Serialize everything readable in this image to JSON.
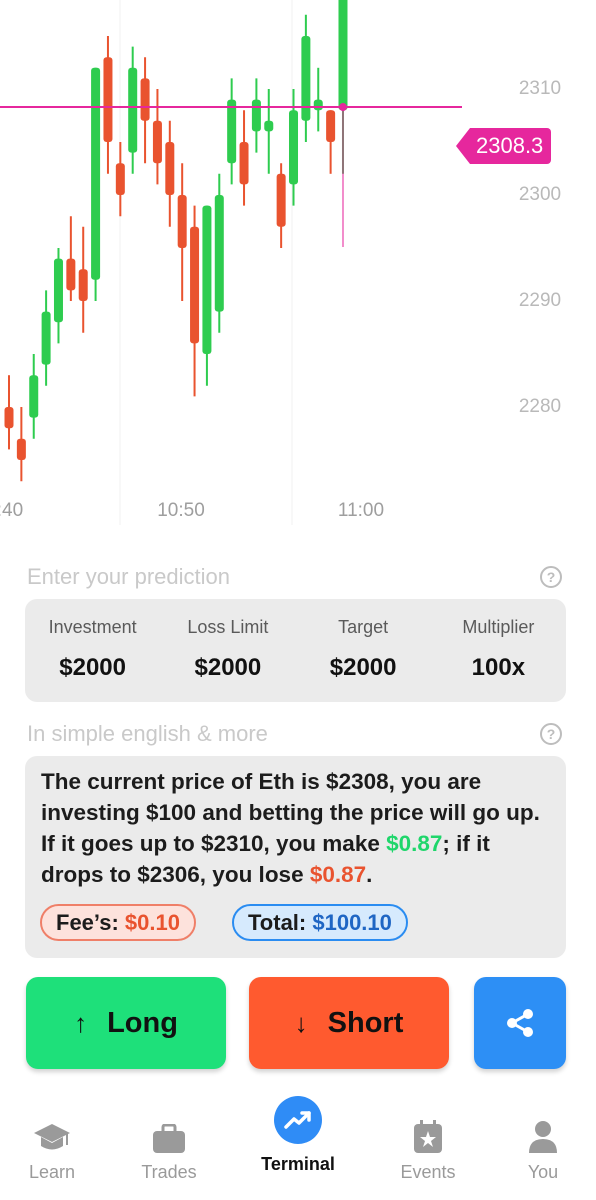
{
  "chart": {
    "current_price": "2308.3",
    "y_ticks": [
      "2310",
      "2300",
      "2290",
      "2280"
    ],
    "x_ticks": [
      ":40",
      "10:50",
      "11:00"
    ],
    "colors": {
      "up": "#2ecc4f",
      "down": "#e9532f",
      "price_line": "#e6279d"
    }
  },
  "chart_data": {
    "type": "candlestick",
    "x": [
      ":40",
      "10:50",
      "11:00"
    ],
    "ylim": [
      2277,
      2321
    ],
    "current_price": 2308.3,
    "candles": [
      {
        "o": 2280,
        "h": 2283,
        "l": 2276,
        "c": 2278
      },
      {
        "o": 2277,
        "h": 2280,
        "l": 2273,
        "c": 2275
      },
      {
        "o": 2279,
        "h": 2285,
        "l": 2277,
        "c": 2283
      },
      {
        "o": 2284,
        "h": 2291,
        "l": 2282,
        "c": 2289
      },
      {
        "o": 2288,
        "h": 2295,
        "l": 2286,
        "c": 2294
      },
      {
        "o": 2294,
        "h": 2298,
        "l": 2290,
        "c": 2291
      },
      {
        "o": 2293,
        "h": 2297,
        "l": 2287,
        "c": 2290
      },
      {
        "o": 2292,
        "h": 2310,
        "l": 2290,
        "c": 2312
      },
      {
        "o": 2313,
        "h": 2315,
        "l": 2302,
        "c": 2305
      },
      {
        "o": 2303,
        "h": 2305,
        "l": 2298,
        "c": 2300
      },
      {
        "o": 2304,
        "h": 2314,
        "l": 2302,
        "c": 2312
      },
      {
        "o": 2311,
        "h": 2313,
        "l": 2303,
        "c": 2307
      },
      {
        "o": 2307,
        "h": 2310,
        "l": 2301,
        "c": 2303
      },
      {
        "o": 2305,
        "h": 2307,
        "l": 2297,
        "c": 2300
      },
      {
        "o": 2300,
        "h": 2303,
        "l": 2290,
        "c": 2295
      },
      {
        "o": 2297,
        "h": 2299,
        "l": 2281,
        "c": 2286
      },
      {
        "o": 2285,
        "h": 2292,
        "l": 2282,
        "c": 2299
      },
      {
        "o": 2289,
        "h": 2302,
        "l": 2287,
        "c": 2300
      },
      {
        "o": 2303,
        "h": 2311,
        "l": 2301,
        "c": 2309
      },
      {
        "o": 2305,
        "h": 2308,
        "l": 2299,
        "c": 2301
      },
      {
        "o": 2306,
        "h": 2311,
        "l": 2304,
        "c": 2309
      },
      {
        "o": 2306,
        "h": 2310,
        "l": 2302,
        "c": 2307
      },
      {
        "o": 2302,
        "h": 2303,
        "l": 2295,
        "c": 2297
      },
      {
        "o": 2301,
        "h": 2310,
        "l": 2299,
        "c": 2308
      },
      {
        "o": 2307,
        "h": 2317,
        "l": 2305,
        "c": 2315
      },
      {
        "o": 2308,
        "h": 2312,
        "l": 2306,
        "c": 2309
      },
      {
        "o": 2308,
        "h": 2306,
        "l": 2302,
        "c": 2305
      },
      {
        "o": 2308,
        "h": 2322,
        "l": 2302,
        "c": 2320
      }
    ]
  },
  "prediction": {
    "section_title": "Enter your prediction",
    "fields": [
      {
        "label": "Investment",
        "value": "$2000"
      },
      {
        "label": "Loss Limit",
        "value": "$2000"
      },
      {
        "label": "Target",
        "value": "$2000"
      },
      {
        "label": "Multiplier",
        "value": "100x"
      }
    ]
  },
  "explanation": {
    "section_title": "In simple english & more",
    "text_part1": "The current price of Eth is $2308, you are investing $100 and betting the price will go up. If it goes up to $2310, you make ",
    "gain": "$0.87",
    "text_part2": "; if it drops to $2306, you lose ",
    "loss": "$0.87",
    "text_part3": ".",
    "fee_label": "Fee’s: ",
    "fee_value": "$0.10",
    "total_label": "Total: ",
    "total_value": "$100.10"
  },
  "actions": {
    "long_label": "Long",
    "short_label": "Short",
    "long_arrow": "↑",
    "short_arrow": "↓"
  },
  "nav": {
    "items": [
      {
        "label": "Learn",
        "icon": "graduation-cap-icon"
      },
      {
        "label": "Trades",
        "icon": "briefcase-icon"
      },
      {
        "label": "Terminal",
        "icon": "trending-up-icon"
      },
      {
        "label": "Events",
        "icon": "calendar-star-icon"
      },
      {
        "label": "You",
        "icon": "person-icon"
      }
    ]
  }
}
